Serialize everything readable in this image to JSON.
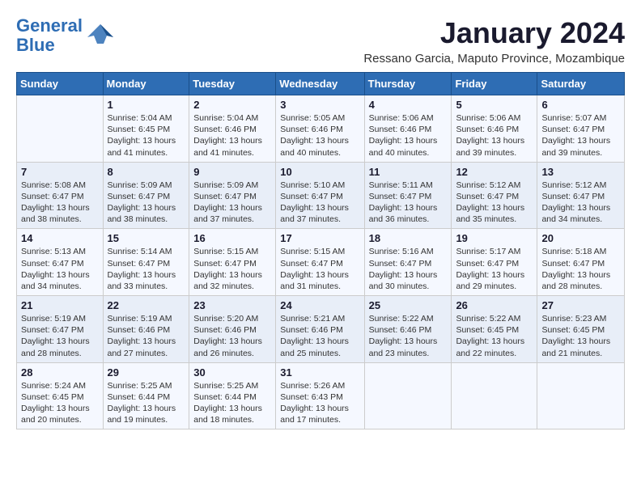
{
  "logo": {
    "line1": "General",
    "line2": "Blue"
  },
  "title": "January 2024",
  "subtitle": "Ressano Garcia, Maputo Province, Mozambique",
  "days_header": [
    "Sunday",
    "Monday",
    "Tuesday",
    "Wednesday",
    "Thursday",
    "Friday",
    "Saturday"
  ],
  "weeks": [
    [
      {
        "num": "",
        "info": ""
      },
      {
        "num": "1",
        "info": "Sunrise: 5:04 AM\nSunset: 6:45 PM\nDaylight: 13 hours\nand 41 minutes."
      },
      {
        "num": "2",
        "info": "Sunrise: 5:04 AM\nSunset: 6:46 PM\nDaylight: 13 hours\nand 41 minutes."
      },
      {
        "num": "3",
        "info": "Sunrise: 5:05 AM\nSunset: 6:46 PM\nDaylight: 13 hours\nand 40 minutes."
      },
      {
        "num": "4",
        "info": "Sunrise: 5:06 AM\nSunset: 6:46 PM\nDaylight: 13 hours\nand 40 minutes."
      },
      {
        "num": "5",
        "info": "Sunrise: 5:06 AM\nSunset: 6:46 PM\nDaylight: 13 hours\nand 39 minutes."
      },
      {
        "num": "6",
        "info": "Sunrise: 5:07 AM\nSunset: 6:47 PM\nDaylight: 13 hours\nand 39 minutes."
      }
    ],
    [
      {
        "num": "7",
        "info": "Sunrise: 5:08 AM\nSunset: 6:47 PM\nDaylight: 13 hours\nand 38 minutes."
      },
      {
        "num": "8",
        "info": "Sunrise: 5:09 AM\nSunset: 6:47 PM\nDaylight: 13 hours\nand 38 minutes."
      },
      {
        "num": "9",
        "info": "Sunrise: 5:09 AM\nSunset: 6:47 PM\nDaylight: 13 hours\nand 37 minutes."
      },
      {
        "num": "10",
        "info": "Sunrise: 5:10 AM\nSunset: 6:47 PM\nDaylight: 13 hours\nand 37 minutes."
      },
      {
        "num": "11",
        "info": "Sunrise: 5:11 AM\nSunset: 6:47 PM\nDaylight: 13 hours\nand 36 minutes."
      },
      {
        "num": "12",
        "info": "Sunrise: 5:12 AM\nSunset: 6:47 PM\nDaylight: 13 hours\nand 35 minutes."
      },
      {
        "num": "13",
        "info": "Sunrise: 5:12 AM\nSunset: 6:47 PM\nDaylight: 13 hours\nand 34 minutes."
      }
    ],
    [
      {
        "num": "14",
        "info": "Sunrise: 5:13 AM\nSunset: 6:47 PM\nDaylight: 13 hours\nand 34 minutes."
      },
      {
        "num": "15",
        "info": "Sunrise: 5:14 AM\nSunset: 6:47 PM\nDaylight: 13 hours\nand 33 minutes."
      },
      {
        "num": "16",
        "info": "Sunrise: 5:15 AM\nSunset: 6:47 PM\nDaylight: 13 hours\nand 32 minutes."
      },
      {
        "num": "17",
        "info": "Sunrise: 5:15 AM\nSunset: 6:47 PM\nDaylight: 13 hours\nand 31 minutes."
      },
      {
        "num": "18",
        "info": "Sunrise: 5:16 AM\nSunset: 6:47 PM\nDaylight: 13 hours\nand 30 minutes."
      },
      {
        "num": "19",
        "info": "Sunrise: 5:17 AM\nSunset: 6:47 PM\nDaylight: 13 hours\nand 29 minutes."
      },
      {
        "num": "20",
        "info": "Sunrise: 5:18 AM\nSunset: 6:47 PM\nDaylight: 13 hours\nand 28 minutes."
      }
    ],
    [
      {
        "num": "21",
        "info": "Sunrise: 5:19 AM\nSunset: 6:47 PM\nDaylight: 13 hours\nand 28 minutes."
      },
      {
        "num": "22",
        "info": "Sunrise: 5:19 AM\nSunset: 6:46 PM\nDaylight: 13 hours\nand 27 minutes."
      },
      {
        "num": "23",
        "info": "Sunrise: 5:20 AM\nSunset: 6:46 PM\nDaylight: 13 hours\nand 26 minutes."
      },
      {
        "num": "24",
        "info": "Sunrise: 5:21 AM\nSunset: 6:46 PM\nDaylight: 13 hours\nand 25 minutes."
      },
      {
        "num": "25",
        "info": "Sunrise: 5:22 AM\nSunset: 6:46 PM\nDaylight: 13 hours\nand 23 minutes."
      },
      {
        "num": "26",
        "info": "Sunrise: 5:22 AM\nSunset: 6:45 PM\nDaylight: 13 hours\nand 22 minutes."
      },
      {
        "num": "27",
        "info": "Sunrise: 5:23 AM\nSunset: 6:45 PM\nDaylight: 13 hours\nand 21 minutes."
      }
    ],
    [
      {
        "num": "28",
        "info": "Sunrise: 5:24 AM\nSunset: 6:45 PM\nDaylight: 13 hours\nand 20 minutes."
      },
      {
        "num": "29",
        "info": "Sunrise: 5:25 AM\nSunset: 6:44 PM\nDaylight: 13 hours\nand 19 minutes."
      },
      {
        "num": "30",
        "info": "Sunrise: 5:25 AM\nSunset: 6:44 PM\nDaylight: 13 hours\nand 18 minutes."
      },
      {
        "num": "31",
        "info": "Sunrise: 5:26 AM\nSunset: 6:43 PM\nDaylight: 13 hours\nand 17 minutes."
      },
      {
        "num": "",
        "info": ""
      },
      {
        "num": "",
        "info": ""
      },
      {
        "num": "",
        "info": ""
      }
    ]
  ]
}
